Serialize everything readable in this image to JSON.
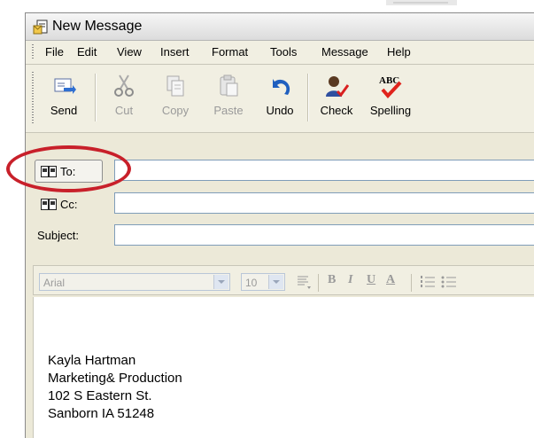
{
  "window": {
    "title": "New Message"
  },
  "menu": [
    "File",
    "Edit",
    "View",
    "Insert",
    "Format",
    "Tools",
    "Message",
    "Help"
  ],
  "toolbar": {
    "send": "Send",
    "cut": "Cut",
    "copy": "Copy",
    "paste": "Paste",
    "undo": "Undo",
    "check": "Check",
    "spelling": "Spelling"
  },
  "header": {
    "to_label": "To:",
    "cc_label": "Cc:",
    "subject_label": "Subject:",
    "to_value": "",
    "cc_value": "",
    "subject_value": ""
  },
  "format": {
    "font": "Arial",
    "size": "10"
  },
  "body": {
    "signature": [
      "Kayla Hartman",
      "Marketing& Production",
      "102 S Eastern St.",
      "Sanborn IA 51248"
    ]
  },
  "icons": [
    "new-message-icon",
    "send-icon",
    "cut-icon",
    "copy-icon",
    "paste-icon",
    "undo-icon",
    "check-names-icon",
    "spelling-icon",
    "address-book-icon"
  ],
  "colors": {
    "callout": "#c8202a",
    "undo": "#1f5fbf",
    "spell": "#e0231c"
  }
}
